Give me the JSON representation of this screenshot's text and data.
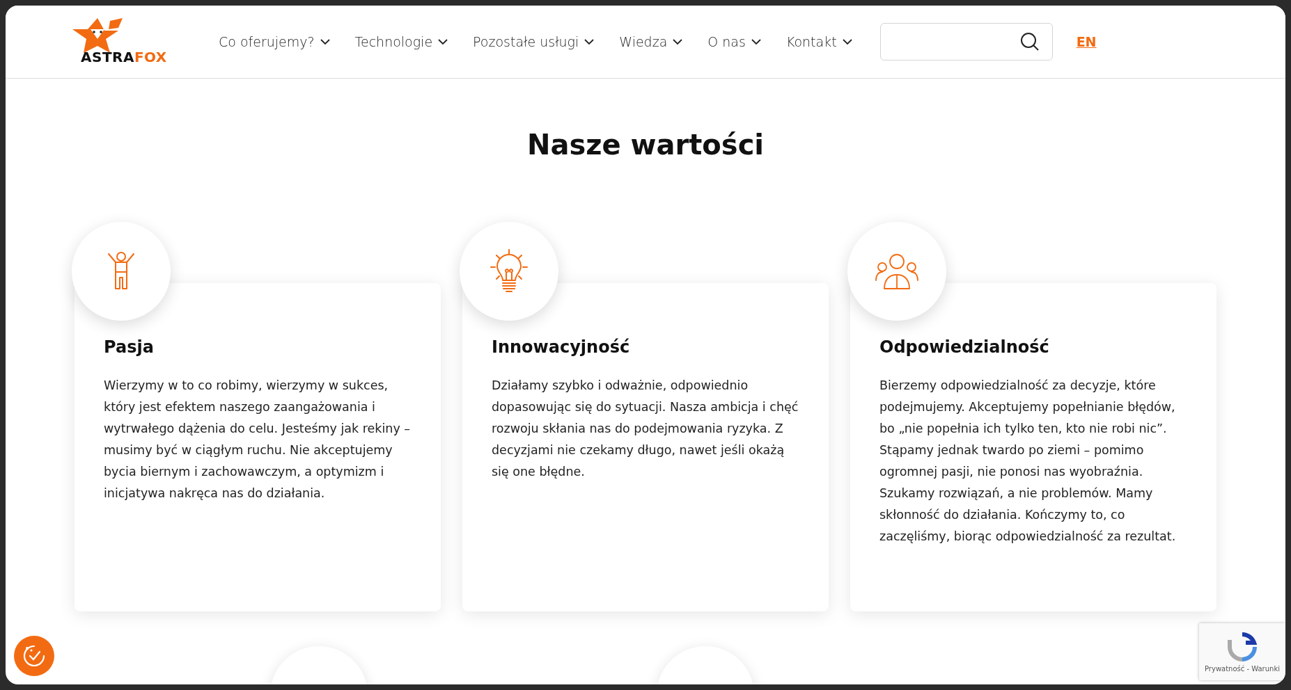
{
  "header": {
    "logo": {
      "part_1": "ASTRA",
      "part_2": "FOX"
    },
    "nav": [
      {
        "label": "Co oferujemy?"
      },
      {
        "label": "Technologie"
      },
      {
        "label": "Pozostałe usługi"
      },
      {
        "label": "Wiedza"
      },
      {
        "label": "O nas"
      },
      {
        "label": "Kontakt"
      }
    ],
    "language": "EN"
  },
  "title": "Nasze wartości",
  "values": [
    {
      "kind": "person",
      "title": "Pasja",
      "text": "Wierzymy w to co robimy, wierzymy w sukces, który jest efektem naszego zaangażowania i wytrwałego dążenia do celu. Jesteśmy jak rekiny – musimy być w ciągłym ruchu. Nie akceptujemy bycia biernym i zachowawczym, a optymizm i inicjatywa nakręca nas do działania."
    },
    {
      "kind": "bulb",
      "title": "Innowacyjność",
      "text": "Działamy szybko i odważnie, odpowiednio dopasowując się do sytuacji. Nasza ambicja i chęć rozwoju skłania nas do podejmowania ryzyka. Z decyzjami nie czekamy długo, nawet jeśli okażą się one błędne."
    },
    {
      "kind": "people",
      "title": "Odpowiedzialność",
      "text": "Bierzemy odpowiedzialność za decyzje, które podejmujemy. Akceptujemy popełnianie błędów, bo „nie popełnia ich tylko ten, kto nie robi nic”. Stąpamy jednak twardo po ziemi – pomimo ogromnej pasji, nie ponosi nas wyobraźnia. Szukamy rozwiązań, a nie problemów. Mamy skłonność do działania. Kończymy to, co zaczęliśmy, biorąc odpowiedzialność za rezultat."
    }
  ],
  "recaptcha": {
    "caption": "Prywatność - Warunki"
  }
}
